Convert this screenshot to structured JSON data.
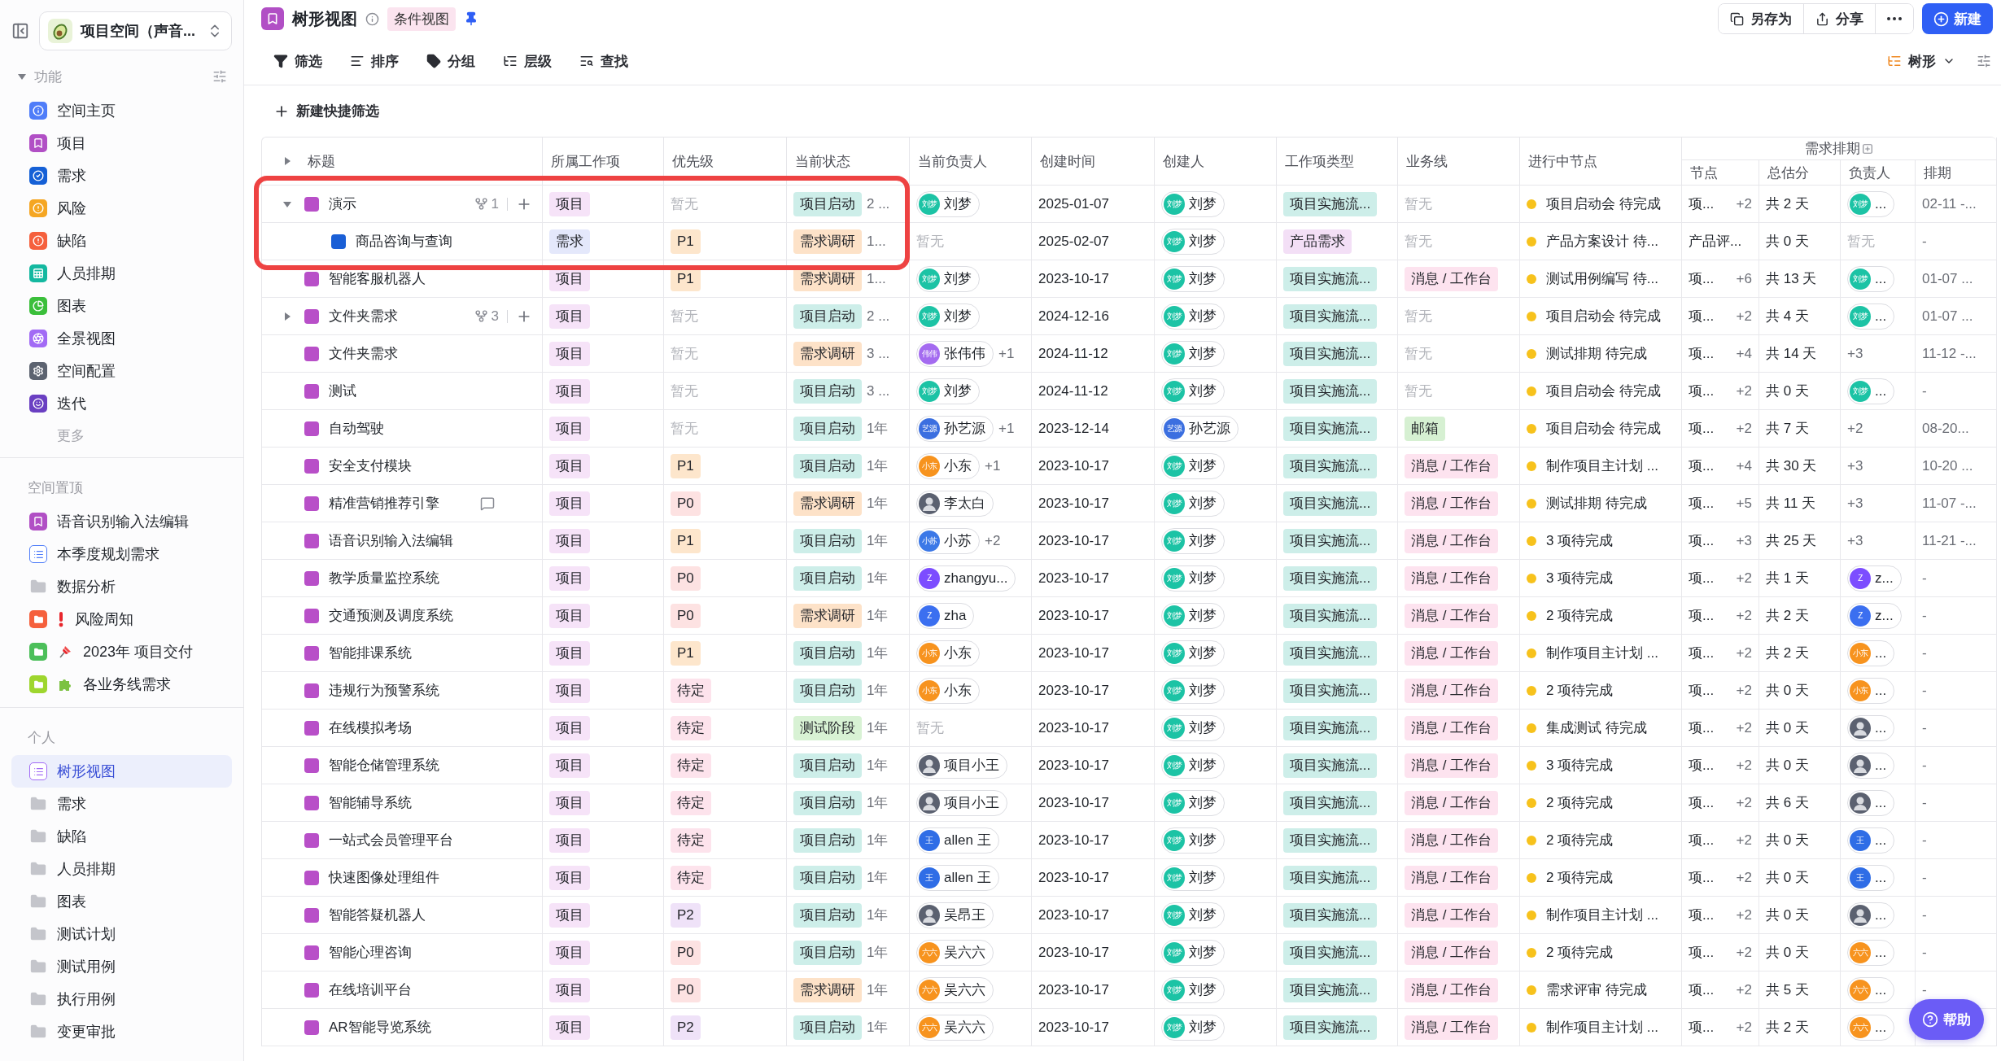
{
  "sidebar": {
    "workspace": "项目空间（声音...",
    "sections": [
      {
        "title": "功能",
        "expanded": true,
        "more": "更多",
        "items": [
          {
            "label": "空间主页",
            "kind": "app",
            "color": "#4f7df9",
            "selected": false
          },
          {
            "label": "项目",
            "kind": "app",
            "color": "#b14fc5",
            "selected": false
          },
          {
            "label": "需求",
            "kind": "app",
            "color": "#1560d6",
            "selected": false
          },
          {
            "label": "风险",
            "kind": "app",
            "color": "#f5a623",
            "selected": false
          },
          {
            "label": "缺陷",
            "kind": "app",
            "color": "#f5603d",
            "selected": false
          },
          {
            "label": "人员排期",
            "kind": "app",
            "color": "#14b8a0",
            "selected": false
          },
          {
            "label": "图表",
            "kind": "app",
            "color": "#3bbf3b",
            "selected": false
          },
          {
            "label": "全景视图",
            "kind": "app",
            "color": "#a26bf5",
            "selected": false
          },
          {
            "label": "空间配置",
            "kind": "app",
            "color": "#5c6370",
            "selected": false
          },
          {
            "label": "迭代",
            "kind": "app",
            "color": "#6a3fc2",
            "selected": false
          }
        ]
      },
      {
        "title": "空间置顶",
        "items": [
          {
            "label": "语音识别输入法编辑",
            "kind": "bookmark",
            "color": "#b14fc5",
            "selected": false
          },
          {
            "label": "本季度规划需求",
            "kind": "list",
            "color": "#4f7df9",
            "selected": false
          },
          {
            "label": "数据分析",
            "kind": "folder",
            "selected": false
          },
          {
            "label": "风险周知",
            "kind": "tile-folder",
            "color": "#f5603d",
            "selected": false
          },
          {
            "label": "2023年 项目交付",
            "kind": "tile-folder",
            "color": "#4cbf5a",
            "selected": false
          },
          {
            "label": "各业务线需求",
            "kind": "tile-folder",
            "color": "#9ed62e",
            "selected": false
          }
        ]
      },
      {
        "title": "个人",
        "items": [
          {
            "label": "树形视图",
            "kind": "list",
            "color": "#a26bf5",
            "selected": true
          },
          {
            "label": "需求",
            "kind": "folder",
            "selected": false
          },
          {
            "label": "缺陷",
            "kind": "folder",
            "selected": false
          },
          {
            "label": "人员排期",
            "kind": "folder",
            "selected": false
          },
          {
            "label": "图表",
            "kind": "folder",
            "selected": false
          },
          {
            "label": "测试计划",
            "kind": "folder",
            "selected": false
          },
          {
            "label": "测试用例",
            "kind": "folder",
            "selected": false
          },
          {
            "label": "执行用例",
            "kind": "folder",
            "selected": false
          },
          {
            "label": "变更审批",
            "kind": "folder",
            "selected": false
          }
        ]
      }
    ]
  },
  "header": {
    "title": "树形视图",
    "view_tag": "条件视图",
    "pinned": true,
    "actions": [
      "另存为",
      "分享"
    ],
    "new_button": "新建"
  },
  "toolbar": {
    "tools": [
      "筛选",
      "排序",
      "分组",
      "层级",
      "查找"
    ],
    "view_mode": "树形"
  },
  "quick_filter": "新建快捷筛选",
  "table": {
    "columns": [
      "所属工作项",
      "优先级",
      "当前状态",
      "当前负责人",
      "创建时间",
      "创建人",
      "工作项类型",
      "业务线",
      "进行中节点"
    ],
    "title_column": "标题",
    "group": {
      "label": "需求排期",
      "columns": [
        "节点",
        "总估分",
        "负责人",
        "排期"
      ]
    },
    "rows": [
      {
        "title": "演示",
        "color": "#b84fc8",
        "expanded": true,
        "sub_count": "1",
        "highlighted": true,
        "work_item": {
          "kind": "tag",
          "text": "项目",
          "color": "#f6e3f8"
        },
        "priority": {
          "kind": "empty",
          "text": "暂无"
        },
        "status": {
          "kind": "tag",
          "text": "项目启动",
          "color": "#cdeee9"
        },
        "status_age": "2 ...",
        "owner": {
          "kind": "person",
          "name": "刘梦",
          "avatar": {
            "kind": "initials",
            "text": "刘梦",
            "color": "#1cc3a5"
          }
        },
        "created": "2025-01-07",
        "creator": {
          "kind": "person",
          "name": "刘梦",
          "avatar": {
            "kind": "initials",
            "text": "刘梦",
            "color": "#1cc3a5"
          }
        },
        "type": {
          "kind": "tag",
          "text": "项目实施流...",
          "color": "#cdeee9"
        },
        "line": {
          "kind": "empty",
          "text": "暂无"
        },
        "node": "项目启动会 待完成",
        "plan_node": "项...",
        "plan_node_extra": "+2",
        "plan_total": "共 2 天",
        "plan_owner": {
          "kind": "person",
          "name": "...",
          "avatar": {
            "kind": "initials",
            "text": "刘梦",
            "color": "#1cc3a5"
          }
        },
        "plan_date": "02-11 -...",
        "children": [
          {
            "title": "商品咨询与查询",
            "color": "#1a5fd6",
            "highlighted": true,
            "work_item": {
              "kind": "tag",
              "text": "需求",
              "color": "#e4e8fb"
            },
            "priority": {
              "kind": "tag",
              "text": "P1",
              "color": "#fde6cc"
            },
            "status": {
              "kind": "tag",
              "text": "需求调研",
              "color": "#fde2c8"
            },
            "status_age": "1...",
            "owner": {
              "kind": "empty",
              "text": "暂无"
            },
            "created": "2025-02-07",
            "creator": {
              "kind": "person",
              "name": "刘梦",
              "avatar": {
                "kind": "initials",
                "text": "刘梦",
                "color": "#1cc3a5"
              }
            },
            "type": {
              "kind": "tag",
              "text": "产品需求",
              "color": "#f3dff6"
            },
            "line": {
              "kind": "empty",
              "text": "暂无"
            },
            "node": "产品方案设计 待...",
            "plan_node": "产品评...",
            "plan_total": "共 0 天",
            "plan_owner": {
              "kind": "empty",
              "text": "暂无"
            },
            "plan_date": "-"
          }
        ]
      },
      {
        "title": "智能客服机器人",
        "color": "#b84fc8",
        "highlighted": false,
        "work_item": {
          "kind": "tag",
          "text": "项目",
          "color": "#f6e3f8"
        },
        "priority": {
          "kind": "tag",
          "text": "P1",
          "color": "#fde6cc"
        },
        "status": {
          "kind": "tag",
          "text": "需求调研",
          "color": "#fde2c8"
        },
        "status_age": "1...",
        "owner": {
          "kind": "person",
          "name": "刘梦",
          "avatar": {
            "kind": "initials",
            "text": "刘梦",
            "color": "#1cc3a5"
          }
        },
        "created": "2023-10-17",
        "creator": {
          "kind": "person",
          "name": "刘梦",
          "avatar": {
            "kind": "initials",
            "text": "刘梦",
            "color": "#1cc3a5"
          }
        },
        "type": {
          "kind": "tag",
          "text": "项目实施流...",
          "color": "#cdeee9"
        },
        "line": {
          "kind": "tag",
          "text": "消息 / 工作台",
          "color": "#fde3ef"
        },
        "node": "测试用例编写 待...",
        "plan_node": "项...",
        "plan_node_extra": "+6",
        "plan_total": "共 13 天",
        "plan_owner": {
          "kind": "person",
          "name": "...",
          "avatar": {
            "kind": "initials",
            "text": "刘梦",
            "color": "#1cc3a5"
          }
        },
        "plan_date": "01-07 ..."
      },
      {
        "title": "文件夹需求",
        "color": "#b84fc8",
        "expanded": false,
        "sub_count": "3",
        "highlighted": false,
        "work_item": {
          "kind": "tag",
          "text": "项目",
          "color": "#f6e3f8"
        },
        "priority": {
          "kind": "empty",
          "text": "暂无"
        },
        "status": {
          "kind": "tag",
          "text": "项目启动",
          "color": "#cdeee9"
        },
        "status_age": "2 ...",
        "owner": {
          "kind": "person",
          "name": "刘梦",
          "avatar": {
            "kind": "initials",
            "text": "刘梦",
            "color": "#1cc3a5"
          }
        },
        "created": "2024-12-16",
        "creator": {
          "kind": "person",
          "name": "刘梦",
          "avatar": {
            "kind": "initials",
            "text": "刘梦",
            "color": "#1cc3a5"
          }
        },
        "type": {
          "kind": "tag",
          "text": "项目实施流...",
          "color": "#cdeee9"
        },
        "line": {
          "kind": "empty",
          "text": "暂无"
        },
        "node": "项目启动会 待完成",
        "plan_node": "项...",
        "plan_node_extra": "+2",
        "plan_total": "共 4 天",
        "plan_owner": {
          "kind": "person",
          "name": "...",
          "avatar": {
            "kind": "initials",
            "text": "刘梦",
            "color": "#1cc3a5"
          }
        },
        "plan_date": "01-07 ..."
      },
      {
        "title": "文件夹需求",
        "color": "#b84fc8",
        "highlighted": false,
        "work_item": {
          "kind": "tag",
          "text": "项目",
          "color": "#f6e3f8"
        },
        "priority": {
          "kind": "empty",
          "text": "暂无"
        },
        "status": {
          "kind": "tag",
          "text": "需求调研",
          "color": "#fde2c8"
        },
        "status_age": "3 ...",
        "owner": {
          "kind": "person",
          "name": "张伟伟",
          "extra": "+1",
          "avatar": {
            "kind": "initials",
            "text": "伟伟",
            "color": "#a46bf0"
          }
        },
        "created": "2024-11-12",
        "creator": {
          "kind": "person",
          "name": "刘梦",
          "avatar": {
            "kind": "initials",
            "text": "刘梦",
            "color": "#1cc3a5"
          }
        },
        "type": {
          "kind": "tag",
          "text": "项目实施流...",
          "color": "#cdeee9"
        },
        "line": {
          "kind": "empty",
          "text": "暂无"
        },
        "node": "测试排期 待完成",
        "plan_node": "项...",
        "plan_node_extra": "+4",
        "plan_total": "共 14 天",
        "plan_owner": {
          "kind": "count",
          "text": "+3"
        },
        "plan_date": "11-12 -..."
      },
      {
        "title": "测试",
        "color": "#b84fc8",
        "highlighted": false,
        "work_item": {
          "kind": "tag",
          "text": "项目",
          "color": "#f6e3f8"
        },
        "priority": {
          "kind": "empty",
          "text": "暂无"
        },
        "status": {
          "kind": "tag",
          "text": "项目启动",
          "color": "#cdeee9"
        },
        "status_age": "3 ...",
        "owner": {
          "kind": "person",
          "name": "刘梦",
          "avatar": {
            "kind": "initials",
            "text": "刘梦",
            "color": "#1cc3a5"
          }
        },
        "created": "2024-11-12",
        "creator": {
          "kind": "person",
          "name": "刘梦",
          "avatar": {
            "kind": "initials",
            "text": "刘梦",
            "color": "#1cc3a5"
          }
        },
        "type": {
          "kind": "tag",
          "text": "项目实施流...",
          "color": "#cdeee9"
        },
        "line": {
          "kind": "empty",
          "text": "暂无"
        },
        "node": "项目启动会 待完成",
        "plan_node": "项...",
        "plan_node_extra": "+2",
        "plan_total": "共 0 天",
        "plan_owner": {
          "kind": "person",
          "name": "...",
          "avatar": {
            "kind": "initials",
            "text": "刘梦",
            "color": "#1cc3a5"
          }
        },
        "plan_date": "-"
      },
      {
        "title": "自动驾驶",
        "color": "#b84fc8",
        "highlighted": false,
        "work_item": {
          "kind": "tag",
          "text": "项目",
          "color": "#f6e3f8"
        },
        "priority": {
          "kind": "empty",
          "text": "暂无"
        },
        "status": {
          "kind": "tag",
          "text": "项目启动",
          "color": "#cdeee9"
        },
        "status_age": "1年",
        "owner": {
          "kind": "person",
          "name": "孙艺源",
          "extra": "+1",
          "avatar": {
            "kind": "initials",
            "text": "艺源",
            "color": "#3b6fe0"
          }
        },
        "created": "2023-12-14",
        "creator": {
          "kind": "person",
          "name": "孙艺源",
          "avatar": {
            "kind": "initials",
            "text": "艺源",
            "color": "#3b6fe0"
          }
        },
        "type": {
          "kind": "tag",
          "text": "项目实施流...",
          "color": "#cdeee9"
        },
        "line": {
          "kind": "tag",
          "text": "邮箱",
          "color": "#d6f0d2"
        },
        "node": "项目启动会 待完成",
        "plan_node": "项...",
        "plan_node_extra": "+2",
        "plan_total": "共 7 天",
        "plan_owner": {
          "kind": "count",
          "text": "+2"
        },
        "plan_date": "08-20..."
      },
      {
        "title": "安全支付模块",
        "color": "#b84fc8",
        "highlighted": false,
        "work_item": {
          "kind": "tag",
          "text": "项目",
          "color": "#f6e3f8"
        },
        "priority": {
          "kind": "tag",
          "text": "P1",
          "color": "#fde6cc"
        },
        "status": {
          "kind": "tag",
          "text": "项目启动",
          "color": "#cdeee9"
        },
        "status_age": "1年",
        "owner": {
          "kind": "person",
          "name": "小东",
          "extra": "+1",
          "avatar": {
            "kind": "initials",
            "text": "小东",
            "color": "#f7931e"
          }
        },
        "created": "2023-10-17",
        "creator": {
          "kind": "person",
          "name": "刘梦",
          "avatar": {
            "kind": "initials",
            "text": "刘梦",
            "color": "#1cc3a5"
          }
        },
        "type": {
          "kind": "tag",
          "text": "项目实施流...",
          "color": "#cdeee9"
        },
        "line": {
          "kind": "tag",
          "text": "消息 / 工作台",
          "color": "#fde3ef"
        },
        "node": "制作项目主计划 ...",
        "plan_node": "项...",
        "plan_node_extra": "+4",
        "plan_total": "共 30 天",
        "plan_owner": {
          "kind": "count",
          "text": "+3"
        },
        "plan_date": "10-20 ..."
      },
      {
        "title": "精准营销推荐引擎",
        "color": "#b84fc8",
        "comment": true,
        "highlighted": false,
        "work_item": {
          "kind": "tag",
          "text": "项目",
          "color": "#f6e3f8"
        },
        "priority": {
          "kind": "tag",
          "text": "P0",
          "color": "#fde2e2"
        },
        "status": {
          "kind": "tag",
          "text": "需求调研",
          "color": "#fde2c8"
        },
        "status_age": "1年",
        "owner": {
          "kind": "person",
          "name": "李太白",
          "avatar": {
            "kind": "photo"
          }
        },
        "created": "2023-10-17",
        "creator": {
          "kind": "person",
          "name": "刘梦",
          "avatar": {
            "kind": "initials",
            "text": "刘梦",
            "color": "#1cc3a5"
          }
        },
        "type": {
          "kind": "tag",
          "text": "项目实施流...",
          "color": "#cdeee9"
        },
        "line": {
          "kind": "tag",
          "text": "消息 / 工作台",
          "color": "#fde3ef"
        },
        "node": "测试排期 待完成",
        "plan_node": "项...",
        "plan_node_extra": "+5",
        "plan_total": "共 11 天",
        "plan_owner": {
          "kind": "count",
          "text": "+3"
        },
        "plan_date": "11-07 -..."
      },
      {
        "title": "语音识别输入法编辑",
        "color": "#b84fc8",
        "highlighted": false,
        "work_item": {
          "kind": "tag",
          "text": "项目",
          "color": "#f6e3f8"
        },
        "priority": {
          "kind": "tag",
          "text": "P1",
          "color": "#fde6cc"
        },
        "status": {
          "kind": "tag",
          "text": "项目启动",
          "color": "#cdeee9"
        },
        "status_age": "1年",
        "owner": {
          "kind": "person",
          "name": "小苏",
          "extra": "+2",
          "avatar": {
            "kind": "initials",
            "text": "小苏",
            "color": "#3b78e7"
          }
        },
        "created": "2023-10-17",
        "creator": {
          "kind": "person",
          "name": "刘梦",
          "avatar": {
            "kind": "initials",
            "text": "刘梦",
            "color": "#1cc3a5"
          }
        },
        "type": {
          "kind": "tag",
          "text": "项目实施流...",
          "color": "#cdeee9"
        },
        "line": {
          "kind": "tag",
          "text": "消息 / 工作台",
          "color": "#fde3ef"
        },
        "node": "3 项待完成",
        "plan_node": "项...",
        "plan_node_extra": "+3",
        "plan_total": "共 25 天",
        "plan_owner": {
          "kind": "count",
          "text": "+3"
        },
        "plan_date": "11-21 -..."
      },
      {
        "title": "教学质量监控系统",
        "color": "#b84fc8",
        "highlighted": false,
        "work_item": {
          "kind": "tag",
          "text": "项目",
          "color": "#f6e3f8"
        },
        "priority": {
          "kind": "tag",
          "text": "P0",
          "color": "#fde2e2"
        },
        "status": {
          "kind": "tag",
          "text": "项目启动",
          "color": "#cdeee9"
        },
        "status_age": "1年",
        "owner": {
          "kind": "person",
          "name": "zhangyu...",
          "avatar": {
            "kind": "initials",
            "text": "Z",
            "color": "#7c4dff"
          }
        },
        "created": "2023-10-17",
        "creator": {
          "kind": "person",
          "name": "刘梦",
          "avatar": {
            "kind": "initials",
            "text": "刘梦",
            "color": "#1cc3a5"
          }
        },
        "type": {
          "kind": "tag",
          "text": "项目实施流...",
          "color": "#cdeee9"
        },
        "line": {
          "kind": "tag",
          "text": "消息 / 工作台",
          "color": "#fde3ef"
        },
        "node": "3 项待完成",
        "plan_node": "项...",
        "plan_node_extra": "+2",
        "plan_total": "共 1 天",
        "plan_owner": {
          "kind": "person",
          "name": "z...",
          "avatar": {
            "kind": "initials",
            "text": "Z",
            "color": "#7c4dff"
          }
        },
        "plan_date": "-"
      },
      {
        "title": "交通预测及调度系统",
        "color": "#b84fc8",
        "highlighted": false,
        "work_item": {
          "kind": "tag",
          "text": "项目",
          "color": "#f6e3f8"
        },
        "priority": {
          "kind": "tag",
          "text": "P0",
          "color": "#fde2e2"
        },
        "status": {
          "kind": "tag",
          "text": "需求调研",
          "color": "#fde2c8"
        },
        "status_age": "1年",
        "owner": {
          "kind": "person",
          "name": "zha",
          "avatar": {
            "kind": "initials",
            "text": "Z",
            "color": "#3b6ff0"
          }
        },
        "created": "2023-10-17",
        "creator": {
          "kind": "person",
          "name": "刘梦",
          "avatar": {
            "kind": "initials",
            "text": "刘梦",
            "color": "#1cc3a5"
          }
        },
        "type": {
          "kind": "tag",
          "text": "项目实施流...",
          "color": "#cdeee9"
        },
        "line": {
          "kind": "tag",
          "text": "消息 / 工作台",
          "color": "#fde3ef"
        },
        "node": "2 项待完成",
        "plan_node": "项...",
        "plan_node_extra": "+2",
        "plan_total": "共 2 天",
        "plan_owner": {
          "kind": "person",
          "name": "z...",
          "avatar": {
            "kind": "initials",
            "text": "Z",
            "color": "#3b6ff0"
          }
        },
        "plan_date": "-"
      },
      {
        "title": "智能排课系统",
        "color": "#b84fc8",
        "highlighted": false,
        "work_item": {
          "kind": "tag",
          "text": "项目",
          "color": "#f6e3f8"
        },
        "priority": {
          "kind": "tag",
          "text": "P1",
          "color": "#fde6cc"
        },
        "status": {
          "kind": "tag",
          "text": "项目启动",
          "color": "#cdeee9"
        },
        "status_age": "1年",
        "owner": {
          "kind": "person",
          "name": "小东",
          "avatar": {
            "kind": "initials",
            "text": "小东",
            "color": "#f7931e"
          }
        },
        "created": "2023-10-17",
        "creator": {
          "kind": "person",
          "name": "刘梦",
          "avatar": {
            "kind": "initials",
            "text": "刘梦",
            "color": "#1cc3a5"
          }
        },
        "type": {
          "kind": "tag",
          "text": "项目实施流...",
          "color": "#cdeee9"
        },
        "line": {
          "kind": "tag",
          "text": "消息 / 工作台",
          "color": "#fde3ef"
        },
        "node": "制作项目主计划 ...",
        "plan_node": "项...",
        "plan_node_extra": "+2",
        "plan_total": "共 2 天",
        "plan_owner": {
          "kind": "person",
          "name": "...",
          "avatar": {
            "kind": "initials",
            "text": "小东",
            "color": "#f7931e"
          }
        },
        "plan_date": "-"
      },
      {
        "title": "违规行为预警系统",
        "color": "#b84fc8",
        "highlighted": false,
        "work_item": {
          "kind": "tag",
          "text": "项目",
          "color": "#f6e3f8"
        },
        "priority": {
          "kind": "tag",
          "text": "待定",
          "color": "#fde3ec"
        },
        "status": {
          "kind": "tag",
          "text": "项目启动",
          "color": "#cdeee9"
        },
        "status_age": "1年",
        "owner": {
          "kind": "person",
          "name": "小东",
          "avatar": {
            "kind": "initials",
            "text": "小东",
            "color": "#f7931e"
          }
        },
        "created": "2023-10-17",
        "creator": {
          "kind": "person",
          "name": "刘梦",
          "avatar": {
            "kind": "initials",
            "text": "刘梦",
            "color": "#1cc3a5"
          }
        },
        "type": {
          "kind": "tag",
          "text": "项目实施流...",
          "color": "#cdeee9"
        },
        "line": {
          "kind": "tag",
          "text": "消息 / 工作台",
          "color": "#fde3ef"
        },
        "node": "2 项待完成",
        "plan_node": "项...",
        "plan_node_extra": "+2",
        "plan_total": "共 0 天",
        "plan_owner": {
          "kind": "person",
          "name": "...",
          "avatar": {
            "kind": "initials",
            "text": "小东",
            "color": "#f7931e"
          }
        },
        "plan_date": "-"
      },
      {
        "title": "在线模拟考场",
        "color": "#b84fc8",
        "highlighted": false,
        "work_item": {
          "kind": "tag",
          "text": "项目",
          "color": "#f6e3f8"
        },
        "priority": {
          "kind": "tag",
          "text": "待定",
          "color": "#fde3ec"
        },
        "status": {
          "kind": "tag",
          "text": "测试阶段",
          "color": "#d8f2d4"
        },
        "status_age": "1年",
        "owner": {
          "kind": "empty",
          "text": "暂无"
        },
        "created": "2023-10-17",
        "creator": {
          "kind": "person",
          "name": "刘梦",
          "avatar": {
            "kind": "initials",
            "text": "刘梦",
            "color": "#1cc3a5"
          }
        },
        "type": {
          "kind": "tag",
          "text": "项目实施流...",
          "color": "#cdeee9"
        },
        "line": {
          "kind": "tag",
          "text": "消息 / 工作台",
          "color": "#fde3ef"
        },
        "node": "集成测试 待完成",
        "plan_node": "项...",
        "plan_node_extra": "+2",
        "plan_total": "共 0 天",
        "plan_owner": {
          "kind": "person",
          "name": "...",
          "avatar": {
            "kind": "photo"
          }
        },
        "plan_date": "-"
      },
      {
        "title": "智能仓储管理系统",
        "color": "#b84fc8",
        "highlighted": false,
        "work_item": {
          "kind": "tag",
          "text": "项目",
          "color": "#f6e3f8"
        },
        "priority": {
          "kind": "tag",
          "text": "待定",
          "color": "#fde3ec"
        },
        "status": {
          "kind": "tag",
          "text": "项目启动",
          "color": "#cdeee9"
        },
        "status_age": "1年",
        "owner": {
          "kind": "person",
          "name": "项目小王",
          "avatar": {
            "kind": "photo"
          }
        },
        "created": "2023-10-17",
        "creator": {
          "kind": "person",
          "name": "刘梦",
          "avatar": {
            "kind": "initials",
            "text": "刘梦",
            "color": "#1cc3a5"
          }
        },
        "type": {
          "kind": "tag",
          "text": "项目实施流...",
          "color": "#cdeee9"
        },
        "line": {
          "kind": "tag",
          "text": "消息 / 工作台",
          "color": "#fde3ef"
        },
        "node": "3 项待完成",
        "plan_node": "项...",
        "plan_node_extra": "+2",
        "plan_total": "共 0 天",
        "plan_owner": {
          "kind": "person",
          "name": "...",
          "avatar": {
            "kind": "photo"
          }
        },
        "plan_date": "-"
      },
      {
        "title": "智能辅导系统",
        "color": "#b84fc8",
        "highlighted": false,
        "work_item": {
          "kind": "tag",
          "text": "项目",
          "color": "#f6e3f8"
        },
        "priority": {
          "kind": "tag",
          "text": "待定",
          "color": "#fde3ec"
        },
        "status": {
          "kind": "tag",
          "text": "项目启动",
          "color": "#cdeee9"
        },
        "status_age": "1年",
        "owner": {
          "kind": "person",
          "name": "项目小王",
          "avatar": {
            "kind": "photo"
          }
        },
        "created": "2023-10-17",
        "creator": {
          "kind": "person",
          "name": "刘梦",
          "avatar": {
            "kind": "initials",
            "text": "刘梦",
            "color": "#1cc3a5"
          }
        },
        "type": {
          "kind": "tag",
          "text": "项目实施流...",
          "color": "#cdeee9"
        },
        "line": {
          "kind": "tag",
          "text": "消息 / 工作台",
          "color": "#fde3ef"
        },
        "node": "2 项待完成",
        "plan_node": "项...",
        "plan_node_extra": "+2",
        "plan_total": "共 6 天",
        "plan_owner": {
          "kind": "person",
          "name": "...",
          "avatar": {
            "kind": "photo"
          }
        },
        "plan_date": "-"
      },
      {
        "title": "一站式会员管理平台",
        "color": "#b84fc8",
        "highlighted": false,
        "work_item": {
          "kind": "tag",
          "text": "项目",
          "color": "#f6e3f8"
        },
        "priority": {
          "kind": "tag",
          "text": "待定",
          "color": "#fde3ec"
        },
        "status": {
          "kind": "tag",
          "text": "项目启动",
          "color": "#cdeee9"
        },
        "status_age": "1年",
        "owner": {
          "kind": "person",
          "name": "allen 王",
          "avatar": {
            "kind": "initials",
            "text": "王",
            "color": "#2f6de6"
          }
        },
        "created": "2023-10-17",
        "creator": {
          "kind": "person",
          "name": "刘梦",
          "avatar": {
            "kind": "initials",
            "text": "刘梦",
            "color": "#1cc3a5"
          }
        },
        "type": {
          "kind": "tag",
          "text": "项目实施流...",
          "color": "#cdeee9"
        },
        "line": {
          "kind": "tag",
          "text": "消息 / 工作台",
          "color": "#fde3ef"
        },
        "node": "2 项待完成",
        "plan_node": "项...",
        "plan_node_extra": "+2",
        "plan_total": "共 0 天",
        "plan_owner": {
          "kind": "person",
          "name": "...",
          "avatar": {
            "kind": "initials",
            "text": "王",
            "color": "#2f6de6"
          }
        },
        "plan_date": "-"
      },
      {
        "title": "快速图像处理组件",
        "color": "#b84fc8",
        "highlighted": false,
        "work_item": {
          "kind": "tag",
          "text": "项目",
          "color": "#f6e3f8"
        },
        "priority": {
          "kind": "tag",
          "text": "待定",
          "color": "#fde3ec"
        },
        "status": {
          "kind": "tag",
          "text": "项目启动",
          "color": "#cdeee9"
        },
        "status_age": "1年",
        "owner": {
          "kind": "person",
          "name": "allen 王",
          "avatar": {
            "kind": "initials",
            "text": "王",
            "color": "#2f6de6"
          }
        },
        "created": "2023-10-17",
        "creator": {
          "kind": "person",
          "name": "刘梦",
          "avatar": {
            "kind": "initials",
            "text": "刘梦",
            "color": "#1cc3a5"
          }
        },
        "type": {
          "kind": "tag",
          "text": "项目实施流...",
          "color": "#cdeee9"
        },
        "line": {
          "kind": "tag",
          "text": "消息 / 工作台",
          "color": "#fde3ef"
        },
        "node": "2 项待完成",
        "plan_node": "项...",
        "plan_node_extra": "+2",
        "plan_total": "共 0 天",
        "plan_owner": {
          "kind": "person",
          "name": "...",
          "avatar": {
            "kind": "initials",
            "text": "王",
            "color": "#2f6de6"
          }
        },
        "plan_date": "-"
      },
      {
        "title": "智能答疑机器人",
        "color": "#b84fc8",
        "highlighted": false,
        "work_item": {
          "kind": "tag",
          "text": "项目",
          "color": "#f6e3f8"
        },
        "priority": {
          "kind": "tag",
          "text": "P2",
          "color": "#efe2f8"
        },
        "status": {
          "kind": "tag",
          "text": "项目启动",
          "color": "#cdeee9"
        },
        "status_age": "1年",
        "owner": {
          "kind": "person",
          "name": "吴昂王",
          "avatar": {
            "kind": "photo"
          }
        },
        "created": "2023-10-17",
        "creator": {
          "kind": "person",
          "name": "刘梦",
          "avatar": {
            "kind": "initials",
            "text": "刘梦",
            "color": "#1cc3a5"
          }
        },
        "type": {
          "kind": "tag",
          "text": "项目实施流...",
          "color": "#cdeee9"
        },
        "line": {
          "kind": "tag",
          "text": "消息 / 工作台",
          "color": "#fde3ef"
        },
        "node": "制作项目主计划 ...",
        "plan_node": "项...",
        "plan_node_extra": "+2",
        "plan_total": "共 0 天",
        "plan_owner": {
          "kind": "person",
          "name": "...",
          "avatar": {
            "kind": "photo"
          }
        },
        "plan_date": "-"
      },
      {
        "title": "智能心理咨询",
        "color": "#b84fc8",
        "highlighted": false,
        "work_item": {
          "kind": "tag",
          "text": "项目",
          "color": "#f6e3f8"
        },
        "priority": {
          "kind": "tag",
          "text": "P0",
          "color": "#fde2e2"
        },
        "status": {
          "kind": "tag",
          "text": "项目启动",
          "color": "#cdeee9"
        },
        "status_age": "1年",
        "owner": {
          "kind": "person",
          "name": "吴六六",
          "avatar": {
            "kind": "initials",
            "text": "六六",
            "color": "#f7931e"
          }
        },
        "created": "2023-10-17",
        "creator": {
          "kind": "person",
          "name": "刘梦",
          "avatar": {
            "kind": "initials",
            "text": "刘梦",
            "color": "#1cc3a5"
          }
        },
        "type": {
          "kind": "tag",
          "text": "项目实施流...",
          "color": "#cdeee9"
        },
        "line": {
          "kind": "tag",
          "text": "消息 / 工作台",
          "color": "#fde3ef"
        },
        "node": "2 项待完成",
        "plan_node": "项...",
        "plan_node_extra": "+2",
        "plan_total": "共 0 天",
        "plan_owner": {
          "kind": "person",
          "name": "...",
          "avatar": {
            "kind": "initials",
            "text": "六六",
            "color": "#f7931e"
          }
        },
        "plan_date": "-"
      },
      {
        "title": "在线培训平台",
        "color": "#b84fc8",
        "highlighted": false,
        "work_item": {
          "kind": "tag",
          "text": "项目",
          "color": "#f6e3f8"
        },
        "priority": {
          "kind": "tag",
          "text": "P0",
          "color": "#fde2e2"
        },
        "status": {
          "kind": "tag",
          "text": "需求调研",
          "color": "#fde2c8"
        },
        "status_age": "1年",
        "owner": {
          "kind": "person",
          "name": "吴六六",
          "avatar": {
            "kind": "initials",
            "text": "六六",
            "color": "#f7931e"
          }
        },
        "created": "2023-10-17",
        "creator": {
          "kind": "person",
          "name": "刘梦",
          "avatar": {
            "kind": "initials",
            "text": "刘梦",
            "color": "#1cc3a5"
          }
        },
        "type": {
          "kind": "tag",
          "text": "项目实施流...",
          "color": "#cdeee9"
        },
        "line": {
          "kind": "tag",
          "text": "消息 / 工作台",
          "color": "#fde3ef"
        },
        "node": "需求评审 待完成",
        "plan_node": "项...",
        "plan_node_extra": "+2",
        "plan_total": "共 5 天",
        "plan_owner": {
          "kind": "person",
          "name": "...",
          "avatar": {
            "kind": "initials",
            "text": "六六",
            "color": "#f7931e"
          }
        },
        "plan_date": "-"
      },
      {
        "title": "AR智能导览系统",
        "color": "#b84fc8",
        "highlighted": false,
        "work_item": {
          "kind": "tag",
          "text": "项目",
          "color": "#f6e3f8"
        },
        "priority": {
          "kind": "tag",
          "text": "P2",
          "color": "#efe2f8"
        },
        "status": {
          "kind": "tag",
          "text": "项目启动",
          "color": "#cdeee9"
        },
        "status_age": "1年",
        "owner": {
          "kind": "person",
          "name": "吴六六",
          "avatar": {
            "kind": "initials",
            "text": "六六",
            "color": "#f7931e"
          }
        },
        "created": "2023-10-17",
        "creator": {
          "kind": "person",
          "name": "刘梦",
          "avatar": {
            "kind": "initials",
            "text": "刘梦",
            "color": "#1cc3a5"
          }
        },
        "type": {
          "kind": "tag",
          "text": "项目实施流...",
          "color": "#cdeee9"
        },
        "line": {
          "kind": "tag",
          "text": "消息 / 工作台",
          "color": "#fde3ef"
        },
        "node": "制作项目主计划 ...",
        "plan_node": "项...",
        "plan_node_extra": "+2",
        "plan_total": "共 2 天",
        "plan_owner": {
          "kind": "person",
          "name": "...",
          "avatar": {
            "kind": "initials",
            "text": "六六",
            "color": "#f7931e"
          }
        }
      }
    ]
  },
  "help": "帮助"
}
